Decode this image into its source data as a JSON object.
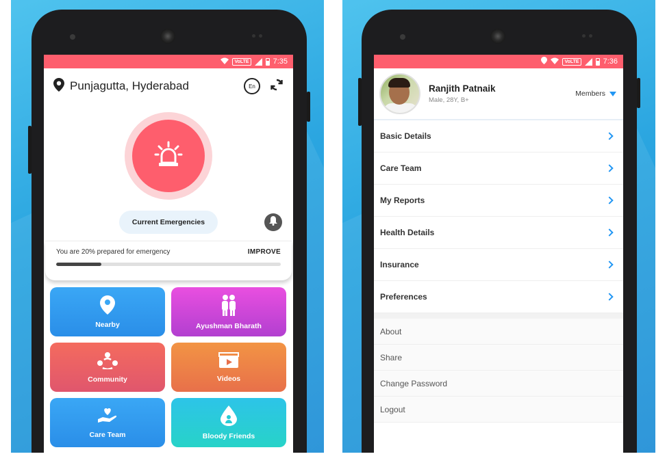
{
  "left_screen": {
    "status": {
      "time": "7:35",
      "network": "VoLTE"
    },
    "location": "Punjagutta, Hyderabad",
    "language_badge": "En",
    "current_emergencies_label": "Current Emergencies",
    "preparedness_text": "You are 20% prepared for emergency",
    "preparedness_fraction": 0.2,
    "improve_label": "IMPROVE",
    "tiles": [
      {
        "label": "Nearby",
        "icon": "map-pin-icon"
      },
      {
        "label": "Ayushman Bharath",
        "icon": "family-icon"
      },
      {
        "label": "Community",
        "icon": "community-icon"
      },
      {
        "label": "Videos",
        "icon": "video-icon"
      },
      {
        "label": "Care Team",
        "icon": "hand-heart-icon"
      },
      {
        "label": "Bloody Friends",
        "icon": "blood-drop-icon"
      }
    ]
  },
  "right_screen": {
    "status": {
      "time": "7:36",
      "network": "VoLTE"
    },
    "profile": {
      "name": "Ranjith Patnaik",
      "meta": "Male, 28Y, B+"
    },
    "members_label": "Members",
    "menu": [
      "Basic Details",
      "Care Team",
      "My Reports",
      "Health Details",
      "Insurance",
      "Preferences"
    ],
    "secondary_menu": [
      "About",
      "Share",
      "Change Password",
      "Logout"
    ]
  },
  "colors": {
    "accent_red": "#fe5e6d",
    "accent_blue": "#2196f3"
  }
}
